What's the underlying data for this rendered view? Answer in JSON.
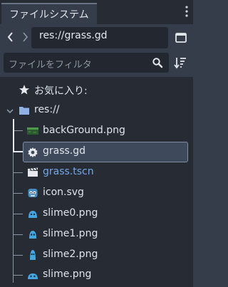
{
  "dock": {
    "tab_title": "ファイルシステム",
    "menu_icon": "kebab-menu-icon"
  },
  "path_bar": {
    "back_icon": "chevron-left-icon",
    "forward_icon": "chevron-right-icon",
    "path": "res://grass.gd",
    "toggle_icon": "split-panel-icon"
  },
  "filter": {
    "placeholder": "ファイルをフィルタ",
    "search_icon": "search-icon",
    "sort_icon": "sort-icon"
  },
  "tree": {
    "favorites": {
      "label": "お気に入り:",
      "icon": "star-icon"
    },
    "root": {
      "label": "res://",
      "icon": "folder-icon",
      "expanded": true
    },
    "files": [
      {
        "name": "backGround.png",
        "icon": "image-thumbnail-icon",
        "selected": false,
        "highlight": false
      },
      {
        "name": "grass.gd",
        "icon": "gear-script-icon",
        "selected": true,
        "highlight": false
      },
      {
        "name": "grass.tscn",
        "icon": "clapperboard-icon",
        "selected": false,
        "highlight": true
      },
      {
        "name": "icon.svg",
        "icon": "godot-logo-icon",
        "selected": false,
        "highlight": false
      },
      {
        "name": "slime0.png",
        "icon": "slime-icon",
        "selected": false,
        "highlight": false
      },
      {
        "name": "slime1.png",
        "icon": "slime-icon",
        "selected": false,
        "highlight": false
      },
      {
        "name": "slime2.png",
        "icon": "slime-icon",
        "selected": false,
        "highlight": false
      },
      {
        "name": "slime.png",
        "icon": "slime-icon",
        "selected": false,
        "highlight": false
      }
    ]
  },
  "colors": {
    "panel_bg": "#363d4a",
    "tree_bg": "#262b34",
    "selected_bg": "#3e4a5c",
    "scene_link": "#76a7e8",
    "icon_blue": "#8fb1e8"
  }
}
